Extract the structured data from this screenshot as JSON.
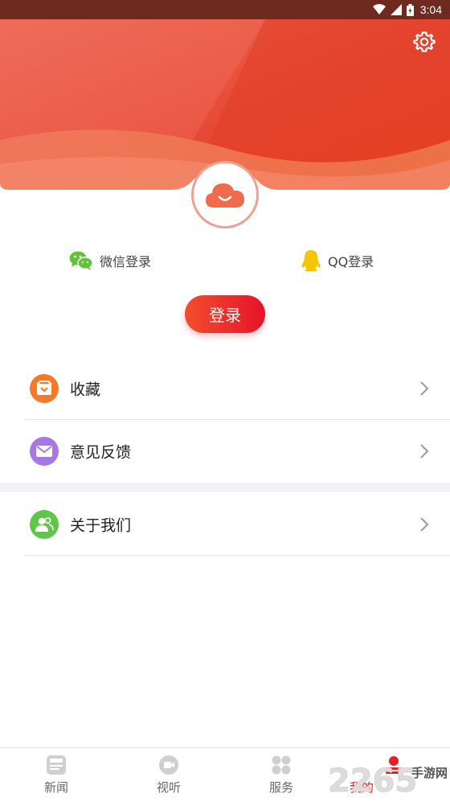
{
  "status_bar": {
    "time": "3:04"
  },
  "header": {
    "settings_icon": "gear-icon"
  },
  "login_options": {
    "wechat": {
      "label": "微信登录",
      "icon": "wechat-icon",
      "color": "#62c338"
    },
    "qq": {
      "label": "QQ登录",
      "icon": "qq-penguin-icon",
      "color": "#f7c400"
    }
  },
  "login_button": {
    "label": "登录"
  },
  "menu": [
    {
      "label": "收藏",
      "icon": "favorites-icon",
      "color": "#f47a2a"
    },
    {
      "label": "意见反馈",
      "icon": "mail-icon",
      "color": "#a877e4"
    },
    {
      "label": "关于我们",
      "icon": "people-icon",
      "color": "#5fc64a"
    }
  ],
  "bottom_nav": [
    {
      "label": "新闻",
      "icon": "news-icon",
      "active": false
    },
    {
      "label": "视听",
      "icon": "video-icon",
      "active": false
    },
    {
      "label": "服务",
      "icon": "services-grid-icon",
      "active": false
    },
    {
      "label": "我的",
      "icon": "profile-icon",
      "active": true
    }
  ],
  "watermark": {
    "number": "2265",
    "text": "手游网"
  },
  "colors": {
    "accent": "#e41f2a",
    "header_gradient_start": "#ec5e4c",
    "header_gradient_end": "#e83b1c"
  }
}
